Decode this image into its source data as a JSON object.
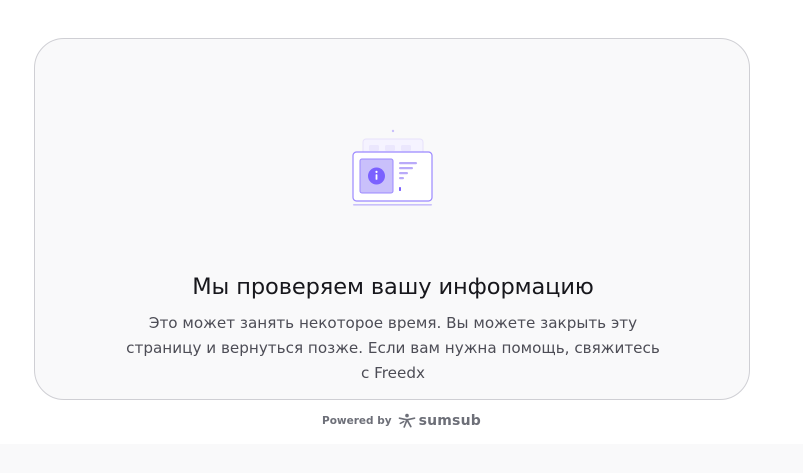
{
  "status": {
    "title": "Мы проверяем вашу информацию",
    "description": "Это может занять некоторое время. Вы можете закрыть эту страницу и вернуться позже. Если вам нужна помощь, свяжитесь с Freedx"
  },
  "footer": {
    "powered_by": "Powered by",
    "brand": "sumsub"
  },
  "icons": {
    "illustration": "document-info-illustration-icon",
    "info": "info-icon",
    "brand_logo": "sumsub-logo-icon"
  },
  "colors": {
    "accent": "#7b61ff",
    "accent_light": "#c9c0fb",
    "card_background": "#f9f9fa",
    "card_border": "#cfcfd4",
    "title_text": "#17171c",
    "body_text": "#4d4d56",
    "footer_text": "#6d6f78"
  }
}
